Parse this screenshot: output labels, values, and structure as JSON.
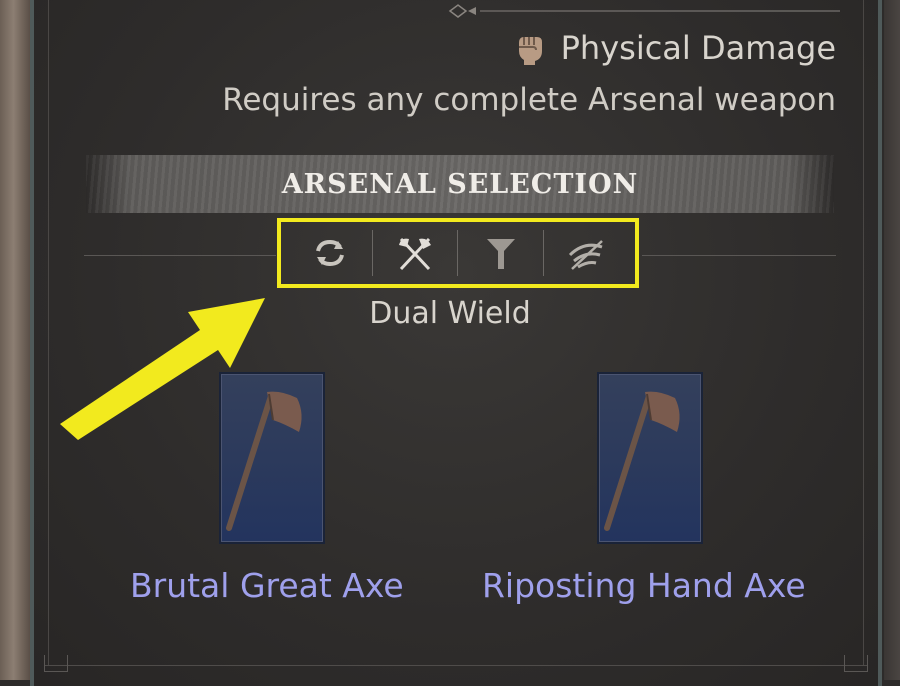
{
  "skill": {
    "damage_icon": "fist-icon",
    "damage_type": "Physical Damage",
    "requirement": "Requires any complete Arsenal weapon"
  },
  "arsenal": {
    "title": "ARSENAL SELECTION",
    "filters": [
      {
        "icon": "swap-icon"
      },
      {
        "icon": "crossed-axes-icon"
      },
      {
        "icon": "funnel-icon"
      },
      {
        "icon": "ranged-wave-icon"
      }
    ],
    "mode": "Dual Wield",
    "weapons": [
      {
        "name": "Brutal Great Axe",
        "icon": "great-axe-icon"
      },
      {
        "name": "Riposting Hand Axe",
        "icon": "hand-axe-icon"
      }
    ]
  },
  "annotation": {
    "highlight_color": "#f2ea1e",
    "arrow_color": "#f2ea1e"
  },
  "colors": {
    "weapon_name": "#9fa0ec",
    "text": "#d8d4cd",
    "card_bg": "#2c3a5c"
  }
}
